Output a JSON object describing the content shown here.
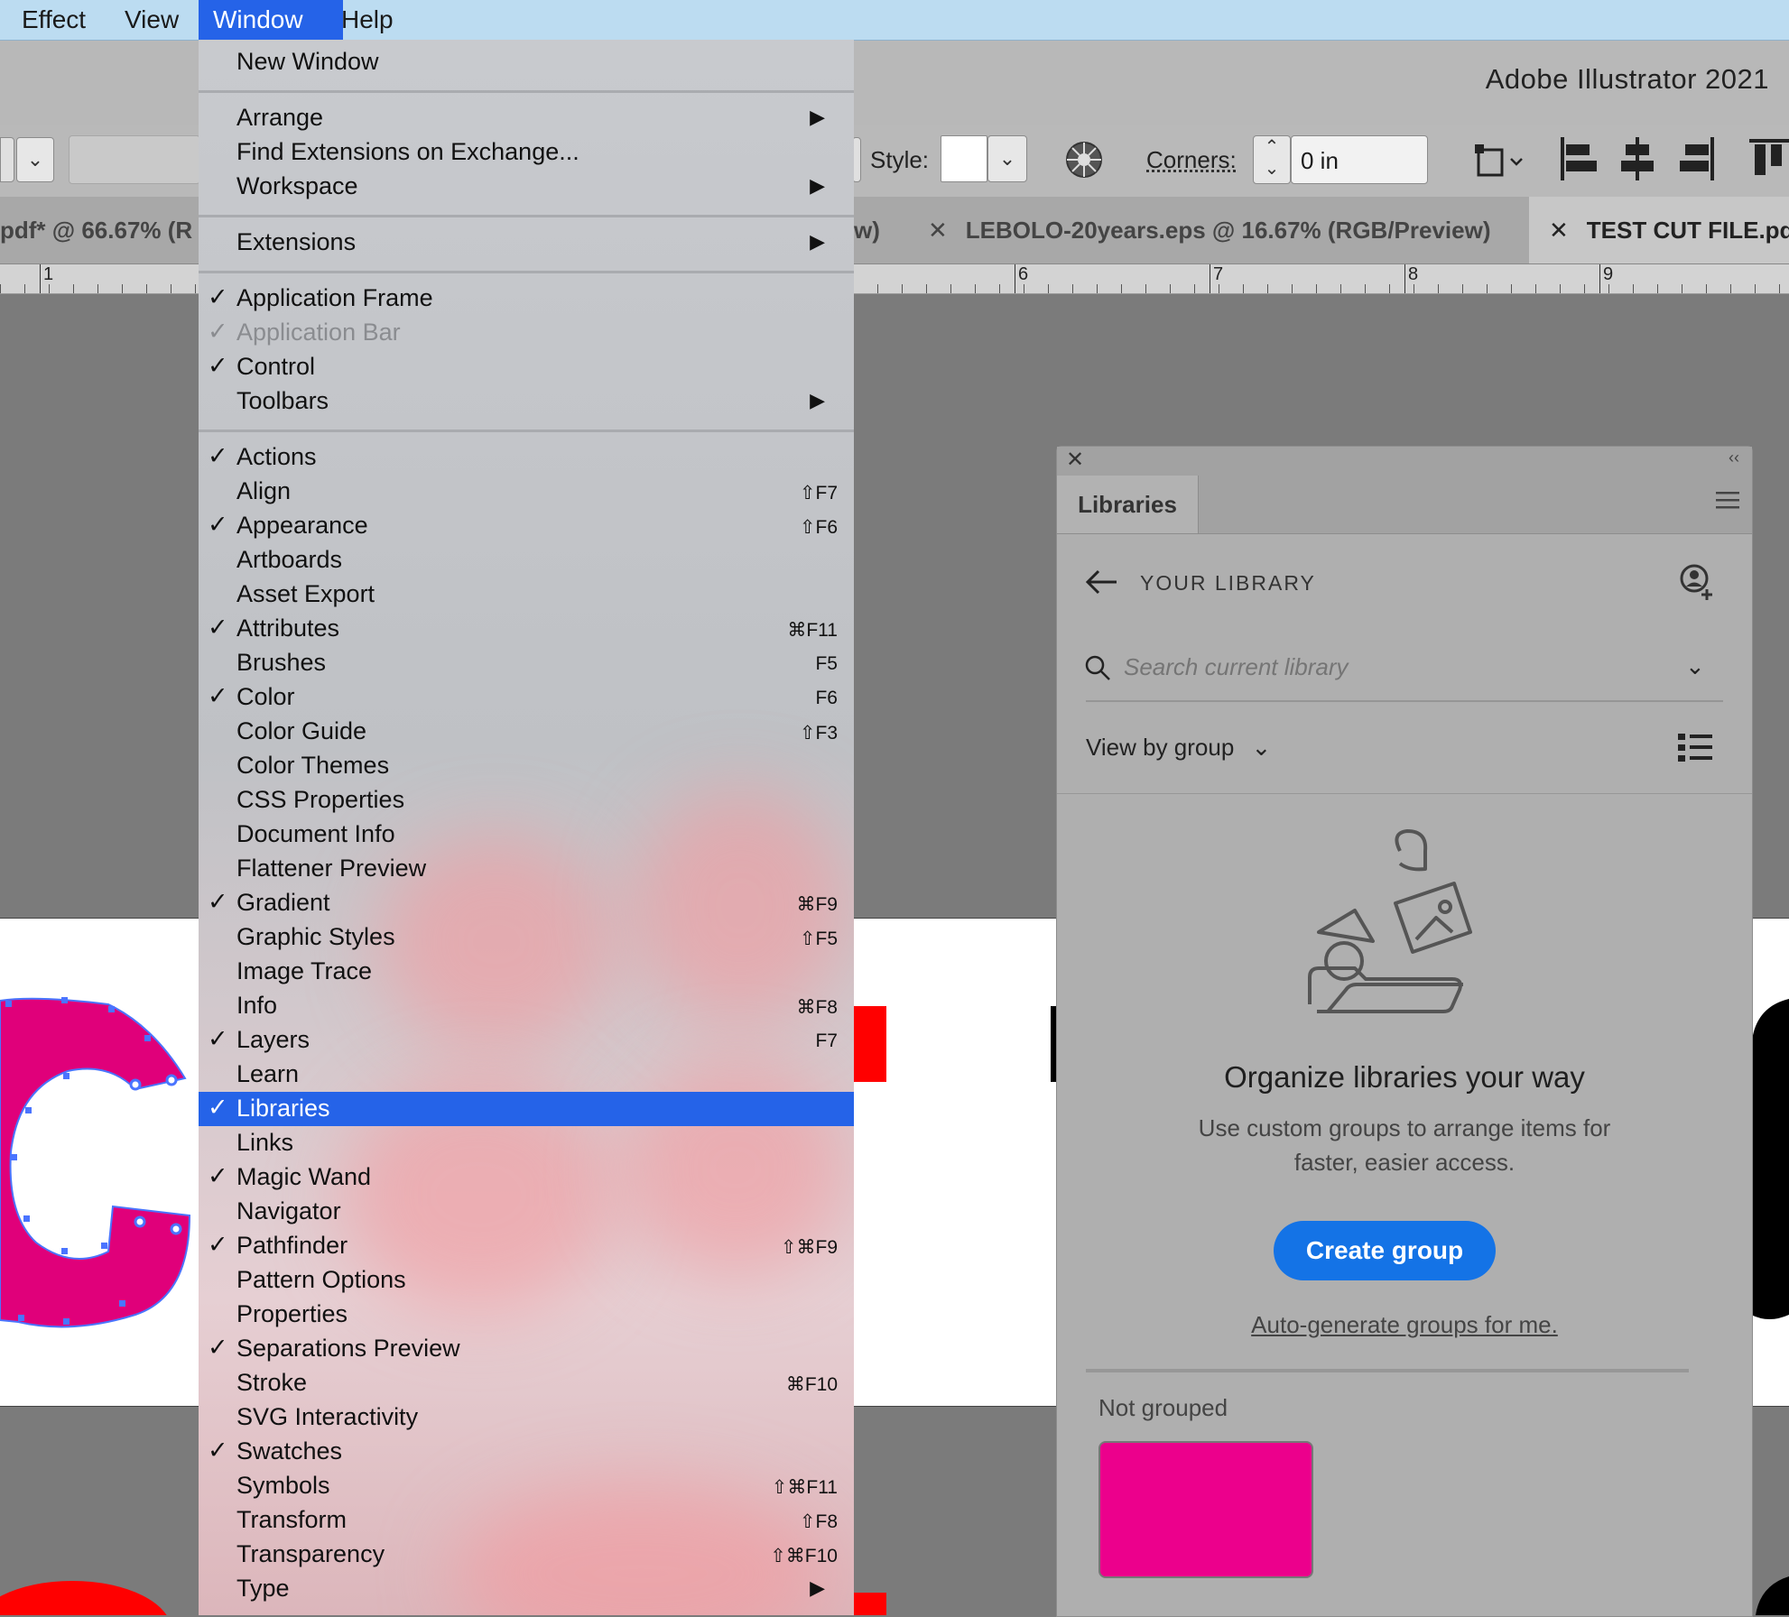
{
  "menubar": {
    "items": [
      {
        "label": "Effect"
      },
      {
        "label": "View"
      },
      {
        "label": "Window"
      },
      {
        "label": "Help"
      }
    ]
  },
  "app": {
    "title": "Adobe Illustrator 2021"
  },
  "control": {
    "style_label": "Style:",
    "corners_label": "Corners:",
    "corners_value": "0 in"
  },
  "doc_tabs": [
    {
      "label": "pdf* @ 66.67% (R"
    },
    {
      "label": "w)"
    },
    {
      "label": "LEBOLO-20years.eps @ 16.67% (RGB/Preview)"
    },
    {
      "label": "TEST CUT FILE.pdf"
    }
  ],
  "ruler": {
    "numbers": [
      "1",
      "6",
      "7",
      "8",
      "9"
    ]
  },
  "window_menu": {
    "items": [
      {
        "label": "New Window"
      },
      {
        "label": "Arrange",
        "submenu": "▶"
      },
      {
        "label": "Find Extensions on Exchange..."
      },
      {
        "label": "Workspace",
        "submenu": "▶"
      },
      {
        "label": "Extensions",
        "submenu": "▶"
      },
      {
        "label": "Application Frame",
        "check": "✓"
      },
      {
        "label": "Application Bar",
        "check": "✓"
      },
      {
        "label": "Control",
        "check": "✓"
      },
      {
        "label": "Toolbars",
        "submenu": "▶"
      },
      {
        "label": "Actions",
        "check": "✓"
      },
      {
        "label": "Align",
        "shortcut": "⇧F7"
      },
      {
        "label": "Appearance",
        "check": "✓",
        "shortcut": "⇧F6"
      },
      {
        "label": "Artboards"
      },
      {
        "label": "Asset Export"
      },
      {
        "label": "Attributes",
        "check": "✓",
        "shortcut": "⌘F11"
      },
      {
        "label": "Brushes",
        "shortcut": "F5"
      },
      {
        "label": "Color",
        "check": "✓",
        "shortcut": "F6"
      },
      {
        "label": "Color Guide",
        "shortcut": "⇧F3"
      },
      {
        "label": "Color Themes"
      },
      {
        "label": "CSS Properties"
      },
      {
        "label": "Document Info"
      },
      {
        "label": "Flattener Preview"
      },
      {
        "label": "Gradient",
        "check": "✓",
        "shortcut": "⌘F9"
      },
      {
        "label": "Graphic Styles",
        "shortcut": "⇧F5"
      },
      {
        "label": "Image Trace"
      },
      {
        "label": "Info",
        "shortcut": "⌘F8"
      },
      {
        "label": "Layers",
        "check": "✓",
        "shortcut": "F7"
      },
      {
        "label": "Learn"
      },
      {
        "label": "Libraries",
        "check": "✓"
      },
      {
        "label": "Links"
      },
      {
        "label": "Magic Wand",
        "check": "✓"
      },
      {
        "label": "Navigator"
      },
      {
        "label": "Pathfinder",
        "check": "✓",
        "shortcut": "⇧⌘F9"
      },
      {
        "label": "Pattern Options"
      },
      {
        "label": "Properties"
      },
      {
        "label": "Separations Preview",
        "check": "✓"
      },
      {
        "label": "Stroke",
        "shortcut": "⌘F10"
      },
      {
        "label": "SVG Interactivity"
      },
      {
        "label": "Swatches",
        "check": "✓"
      },
      {
        "label": "Symbols",
        "shortcut": "⇧⌘F11"
      },
      {
        "label": "Transform",
        "shortcut": "⇧F8"
      },
      {
        "label": "Transparency",
        "shortcut": "⇧⌘F10"
      },
      {
        "label": "Type",
        "submenu": "▶"
      }
    ]
  },
  "libraries": {
    "tab_label": "Libraries",
    "header": "YOUR LIBRARY",
    "search_placeholder": "Search current library",
    "view_by": "View by group",
    "empty_title": "Organize libraries your way",
    "empty_desc_line1": "Use custom groups to arrange items for",
    "empty_desc_line2": "faster, easier access.",
    "create_button": "Create group",
    "auto_link": "Auto-generate groups for me.",
    "not_grouped": "Not grouped",
    "swatch_color": "#ec008c"
  },
  "colors": {
    "menu_highlight": "#2563e8",
    "create_button": "#1473e6",
    "art_magenta": "#e0007a",
    "art_red": "#ff0000"
  }
}
